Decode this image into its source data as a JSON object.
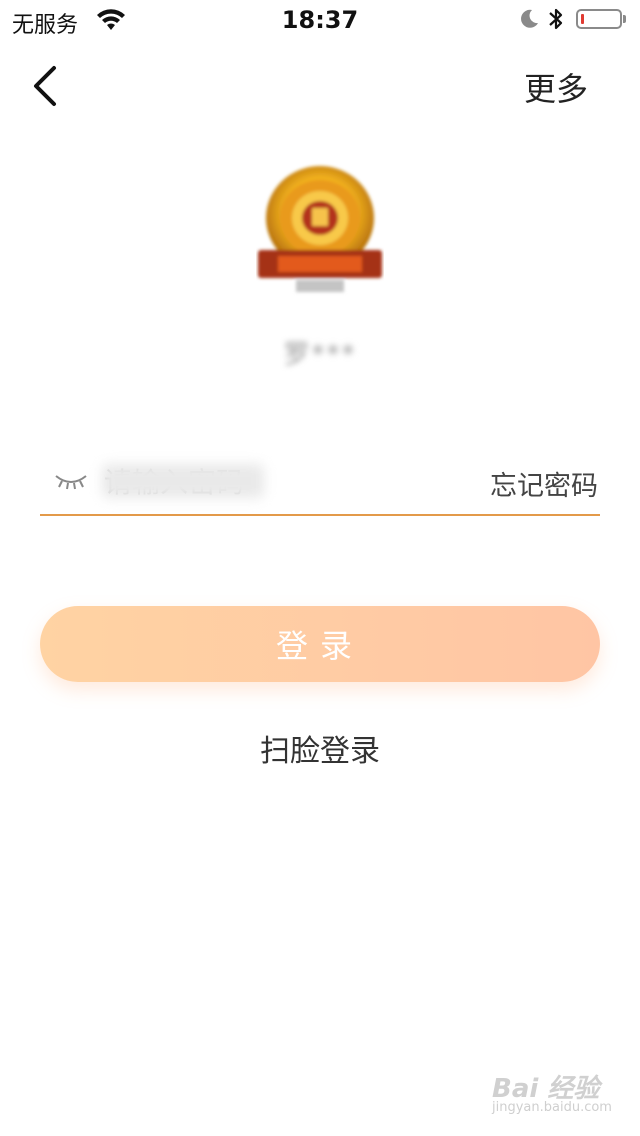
{
  "status_bar": {
    "carrier": "无服务",
    "time": "18:37",
    "battery_percent": 5,
    "wifi_icon": "wifi-icon",
    "moon_icon": "do-not-disturb-icon",
    "bluetooth_icon": "bluetooth-icon"
  },
  "nav": {
    "back_icon": "chevron-left-icon",
    "more_label": "更多"
  },
  "profile": {
    "logo_icon": "emblem-logo",
    "account_name": "罗***"
  },
  "password": {
    "placeholder": "请输入密码",
    "value": "",
    "eye_icon": "eye-closed-icon",
    "forgot_label": "忘记密码"
  },
  "login_button": {
    "label": "登录"
  },
  "face_login_label": "扫脸登录",
  "watermark": {
    "brand": "Bai 经验",
    "sub": "jingyan.baidu.com"
  },
  "colors": {
    "accent": "#e39a4a",
    "button_start": "#ffd3a3",
    "button_end": "#ffc5a4"
  }
}
